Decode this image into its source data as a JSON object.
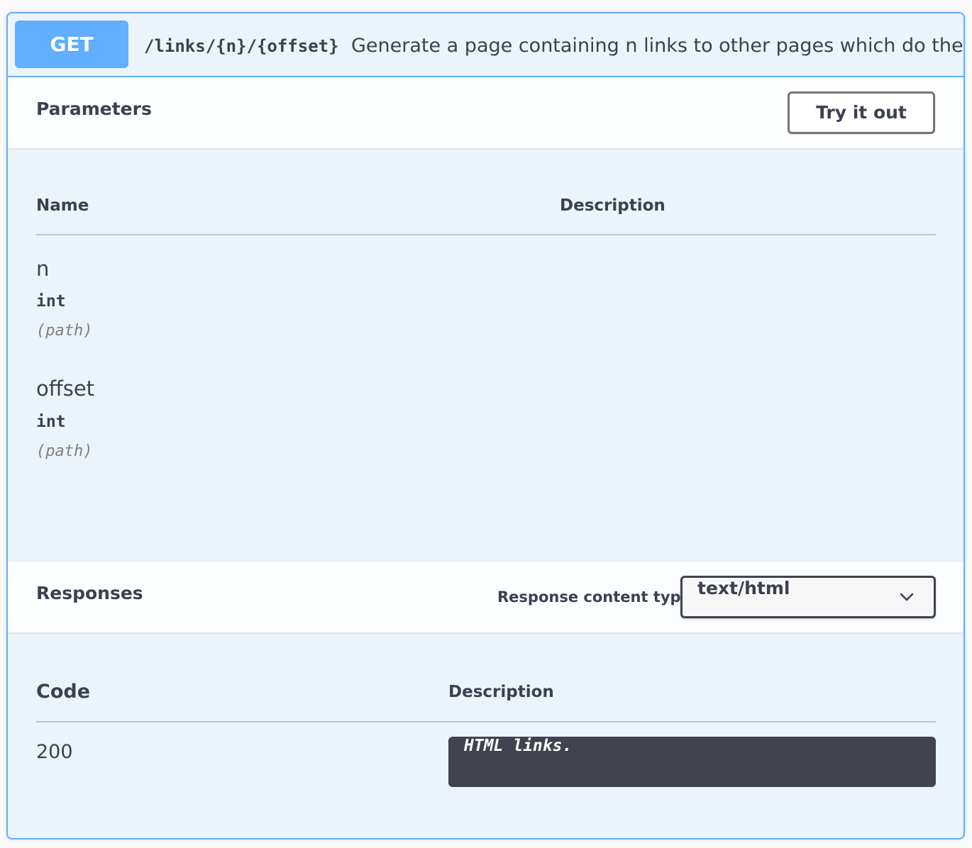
{
  "operation": {
    "method": "GET",
    "path": "/links/{n}/{offset}",
    "summary": "Generate a page containing n links to other pages which do the same.",
    "accent_color": "#61affe"
  },
  "parameters_section": {
    "title": "Parameters",
    "try_button_label": "Try it out",
    "columns": {
      "name": "Name",
      "description": "Description"
    },
    "params": [
      {
        "name": "n",
        "type": "int",
        "in": "(path)"
      },
      {
        "name": "offset",
        "type": "int",
        "in": "(path)"
      }
    ]
  },
  "responses_section": {
    "title": "Responses",
    "content_type_label": "Response content type",
    "content_type_value": "text/html",
    "columns": {
      "code": "Code",
      "description": "Description"
    },
    "responses": [
      {
        "code": "200",
        "description": "HTML links."
      }
    ]
  }
}
